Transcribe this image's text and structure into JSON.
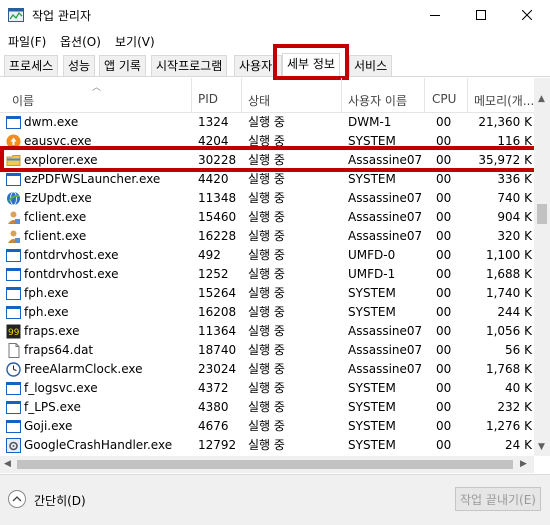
{
  "window": {
    "title": "작업 관리자"
  },
  "menu": [
    "파일(F)",
    "옵션(O)",
    "보기(V)"
  ],
  "tabs": [
    "프로세스",
    "성능",
    "앱 기록",
    "시작프로그램",
    "사용자",
    "세부 정보",
    "서비스"
  ],
  "active_tab": "세부 정보",
  "columns": {
    "name": "이름",
    "pid": "PID",
    "status": "상태",
    "user": "사용자 이름",
    "cpu": "CPU",
    "memory": "메모리(개..."
  },
  "rows": [
    {
      "icon": "window-app-icon",
      "name": "dwm.exe",
      "pid": "1324",
      "status": "실행 중",
      "user": "DWM-1",
      "cpu": "00",
      "memory": "21,360 K"
    },
    {
      "icon": "orange-update-icon",
      "name": "eausvc.exe",
      "pid": "4204",
      "status": "실행 중",
      "user": "SYSTEM",
      "cpu": "00",
      "memory": "116 K"
    },
    {
      "icon": "explorer-folder-icon",
      "name": "explorer.exe",
      "pid": "30228",
      "status": "실행 중",
      "user": "Assassine07",
      "cpu": "00",
      "memory": "35,972 K"
    },
    {
      "icon": "window-app-icon",
      "name": "ezPDFWSLauncher.exe",
      "pid": "4420",
      "status": "실행 중",
      "user": "SYSTEM",
      "cpu": "00",
      "memory": "336 K"
    },
    {
      "icon": "globe-update-icon",
      "name": "EzUpdt.exe",
      "pid": "11348",
      "status": "실행 중",
      "user": "Assassine07",
      "cpu": "00",
      "memory": "740 K"
    },
    {
      "icon": "user-client-icon",
      "name": "fclient.exe",
      "pid": "15460",
      "status": "실행 중",
      "user": "Assassine07",
      "cpu": "00",
      "memory": "904 K"
    },
    {
      "icon": "user-client-icon",
      "name": "fclient.exe",
      "pid": "16228",
      "status": "실행 중",
      "user": "Assassine07",
      "cpu": "00",
      "memory": "320 K"
    },
    {
      "icon": "window-app-icon",
      "name": "fontdrvhost.exe",
      "pid": "492",
      "status": "실행 중",
      "user": "UMFD-0",
      "cpu": "00",
      "memory": "1,100 K"
    },
    {
      "icon": "window-app-icon",
      "name": "fontdrvhost.exe",
      "pid": "1252",
      "status": "실행 중",
      "user": "UMFD-1",
      "cpu": "00",
      "memory": "1,688 K"
    },
    {
      "icon": "window-app-icon",
      "name": "fph.exe",
      "pid": "15264",
      "status": "실행 중",
      "user": "SYSTEM",
      "cpu": "00",
      "memory": "1,740 K"
    },
    {
      "icon": "window-app-icon",
      "name": "fph.exe",
      "pid": "16208",
      "status": "실행 중",
      "user": "SYSTEM",
      "cpu": "00",
      "memory": "244 K"
    },
    {
      "icon": "fraps-icon",
      "name": "fraps.exe",
      "pid": "11364",
      "status": "실행 중",
      "user": "Assassine07",
      "cpu": "00",
      "memory": "1,056 K"
    },
    {
      "icon": "file-icon",
      "name": "fraps64.dat",
      "pid": "18740",
      "status": "실행 중",
      "user": "Assassine07",
      "cpu": "00",
      "memory": "56 K"
    },
    {
      "icon": "clock-icon",
      "name": "FreeAlarmClock.exe",
      "pid": "23024",
      "status": "실행 중",
      "user": "Assassine07",
      "cpu": "00",
      "memory": "1,768 K"
    },
    {
      "icon": "window-app-icon",
      "name": "f_logsvc.exe",
      "pid": "4372",
      "status": "실행 중",
      "user": "SYSTEM",
      "cpu": "00",
      "memory": "40 K"
    },
    {
      "icon": "window-app-icon",
      "name": "f_LPS.exe",
      "pid": "4380",
      "status": "실행 중",
      "user": "SYSTEM",
      "cpu": "00",
      "memory": "232 K"
    },
    {
      "icon": "window-app-icon",
      "name": "Goji.exe",
      "pid": "4676",
      "status": "실행 중",
      "user": "SYSTEM",
      "cpu": "00",
      "memory": "1,276 K"
    },
    {
      "icon": "gear-app-icon",
      "name": "GoogleCrashHandler.exe",
      "pid": "12792",
      "status": "실행 중",
      "user": "SYSTEM",
      "cpu": "00",
      "memory": "24 K"
    }
  ],
  "footer": {
    "collapse_label": "간단히(D)",
    "end_task_label": "작업 끝내기(E)"
  },
  "colors": {
    "highlight": "#c00000",
    "accent_blue": "#1565c0"
  }
}
